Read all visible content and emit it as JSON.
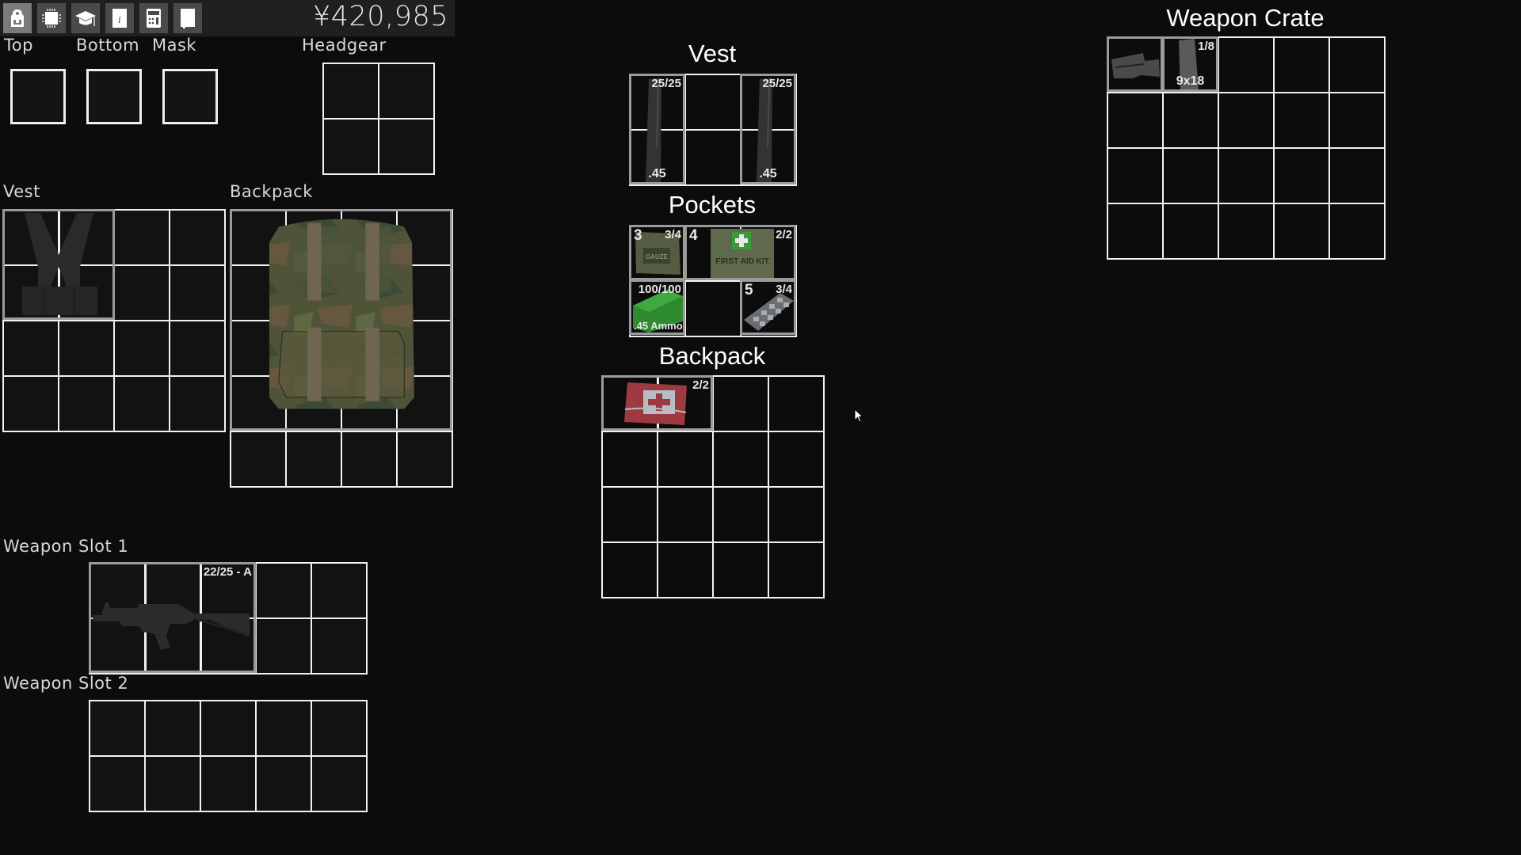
{
  "toolbar": {
    "buttons": [
      {
        "name": "backpack-icon",
        "label": "Inventory",
        "active": true
      },
      {
        "name": "chip-icon",
        "label": "Implants",
        "active": false
      },
      {
        "name": "graduation-cap-icon",
        "label": "Skills",
        "active": false
      },
      {
        "name": "info-book-icon",
        "label": "Info",
        "active": false
      },
      {
        "name": "calculator-icon",
        "label": "Calculator",
        "active": false
      },
      {
        "name": "journal-icon",
        "label": "Journal",
        "active": false
      }
    ],
    "money": "¥420,985"
  },
  "equipment": {
    "top_label": "Top",
    "bottom_label": "Bottom",
    "mask_label": "Mask",
    "headgear_label": "Headgear",
    "vest_label": "Vest",
    "backpack_label": "Backpack",
    "weapon_slot_1_label": "Weapon Slot 1",
    "weapon_slot_2_label": "Weapon Slot 2",
    "vest_item": "Chest Rig",
    "backpack_item": "Camo Backpack",
    "weapon_item": {
      "name": "SMG",
      "ammo": "22/25 - A"
    }
  },
  "containers": {
    "vest": {
      "title": "Vest",
      "items": [
        {
          "name": ".45 Magazine",
          "count": "25/25",
          "caliber": ".45"
        },
        {
          "name": ".45 Magazine",
          "count": "25/25",
          "caliber": ".45"
        }
      ]
    },
    "pockets": {
      "title": "Pockets",
      "items": [
        {
          "name": "Gauze",
          "hotkey": "3",
          "count": "3/4"
        },
        {
          "name": "First Aid Kit",
          "hotkey": "4",
          "count": "2/2",
          "text": "FIRST AID KIT"
        },
        {
          "name": ".45 Ammo",
          "count": "100/100",
          "label": ".45 Ammo"
        },
        {
          "name": "Pills",
          "hotkey": "5",
          "count": "3/4"
        }
      ],
      "gauze_text": "GAUZE"
    },
    "backpack": {
      "title": "Backpack",
      "items": [
        {
          "name": "Medkit",
          "count": "2/2"
        }
      ]
    },
    "weapon_crate": {
      "title": "Weapon Crate",
      "items": [
        {
          "name": "Weapon Stock"
        },
        {
          "name": "9x18 Magazine",
          "count": "1/8",
          "caliber": "9x18"
        }
      ]
    }
  }
}
